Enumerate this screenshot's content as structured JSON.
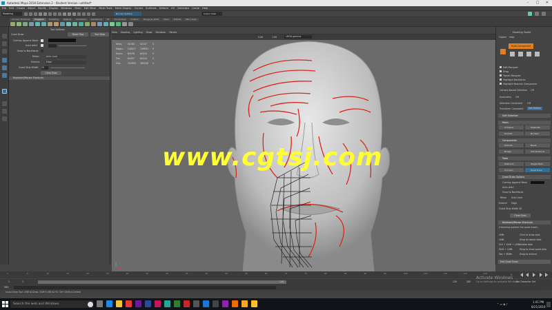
{
  "window": {
    "title": "Autodesk Maya 2016 Extension 2 - Student Version: untitled*"
  },
  "menubar": {
    "items": [
      "File",
      "Edit",
      "Create",
      "Select",
      "Modify",
      "Display",
      "Windows",
      "Mesh",
      "Edit Mesh",
      "Mesh Tools",
      "Mesh Display",
      "Curves",
      "Surfaces",
      "Deform",
      "UV",
      "Generate",
      "Cache",
      "Help"
    ]
  },
  "statusline": {
    "mode": "Modeling",
    "live_surface": "No Live Surface",
    "user": "Autem Shell"
  },
  "shelf": {
    "tabs": [
      "Curves / Surfaces",
      "Polygons",
      "Sculpting",
      "Rigging",
      "Animation",
      "Rendering",
      "FX",
      "FX Caching",
      "Custom",
      "Polygons_Pratt",
      "XGen",
      "Elfhold",
      "Nitro_User"
    ],
    "active_tab": "Polygons"
  },
  "tool_settings": {
    "header": "Tool Settings",
    "title": "Quad Draw",
    "reset": "Reset Tool",
    "help": "Tool Help",
    "overlay_label": "Overlay Append Mesh:",
    "auto_weld_label": "Auto weld:",
    "snap_label": "Snap to Backfaces",
    "relax_label": "Relax:",
    "relax_value": "Auto Lock",
    "extend_label": "Extend:",
    "extend_value": "Edge",
    "strip_label": "Quad Strip Width:",
    "strip_value": "20",
    "clear": "Clear Dots",
    "shortcuts": "Keyboard/Mouse Shortcuts"
  },
  "viewport": {
    "menu": [
      "View",
      "Shading",
      "Lighting",
      "Show",
      "Renderer",
      "Panels"
    ],
    "hud": [
      [
        "Verts:",
        "42180",
        "42147",
        "0"
      ],
      [
        "Edges:",
        "128017",
        "126091",
        "0"
      ],
      [
        "Faces:",
        "84576",
        "84110",
        "0"
      ],
      [
        "Tris:",
        "84497",
        "84110",
        "0"
      ],
      [
        "UVs:",
        "292903",
        "285346",
        "0"
      ]
    ],
    "gamma": "sRGB gamma",
    "val_a": "0.00",
    "val_b": "1.00"
  },
  "watermark": "www.cgtsj.com",
  "modeling_toolkit": {
    "header": "Modeling Toolkit",
    "tabs": [
      "Object",
      "Help"
    ],
    "component": "Multi-Component",
    "options": [
      "Edit Marquee",
      "Drag",
      "Tweak Marquee",
      "Highlight Backfaces",
      "Highlight Nearest Component"
    ],
    "camera_sel": "Camera Based Selection",
    "camera_val": "Off",
    "symmetry": "Symmetry",
    "symmetry_val": "Off",
    "constraint": "Selection Constraint",
    "constraint_val": "Off",
    "transform": "Transform Constraint",
    "transform_val": "Set Edition",
    "soft_sel": "Soft Selection",
    "mesh_hdr": "Mesh",
    "mesh_btns": [
      "Combine",
      "Separate",
      "Smooth",
      "Boolean"
    ],
    "comp_hdr": "Components",
    "comp_btns": [
      "Extrude",
      "Bevel",
      "Bridge",
      "Add Divisions"
    ],
    "tools_hdr": "Tools",
    "tools_btns": [
      "Multi-Cut",
      "Target Weld",
      "Connect",
      "Quad Draw"
    ],
    "qd_hdr": "Quad Draw Options",
    "qd_overlay": "Overlay Append Mesh",
    "qd_weld": "Auto weld",
    "qd_snap": "Snap to Backfaces",
    "qd_relax": "Relax",
    "qd_relax_v": "Auto Lock",
    "qd_extend": "Extend",
    "qd_extend_v": "Edge",
    "qd_strip": "Quad Strip Width",
    "qd_strip_v": "20",
    "qd_clear": "Clear Dots",
    "kb_hdr": "Keyboard/Mouse Shortcuts",
    "kb_desc": "(Hovering outside the quad mesh)",
    "kb_rows": [
      [
        "LMB:",
        "Click to draw dots"
      ],
      [
        "LMB:",
        "Drag to tweak dots"
      ],
      [
        "Ctrl + Shift + LMB:",
        "Delete dots"
      ],
      [
        "Shift + LMB:",
        "Drag to draw quad strip"
      ],
      [
        "Tab + MMB:",
        "Drag to extend"
      ]
    ],
    "exit": "Exit Quad Draw"
  },
  "timeline": {
    "ticks": [
      "1",
      "5",
      "10",
      "15",
      "20",
      "25",
      "30",
      "35",
      "40",
      "45",
      "50",
      "55",
      "60",
      "65",
      "70",
      "75",
      "80",
      "85",
      "90",
      "95",
      "100",
      "105",
      "110",
      "115",
      "120"
    ],
    "start": "1",
    "end": "120",
    "range_start": "1",
    "range_end": "120",
    "range_max": "200",
    "no_char": "No Character Set",
    "mel": "MEL"
  },
  "helpline": "Quad Draw Tool: LMB to Draw, Shift+LMB to Fill, Ctrl+Shift to Delete",
  "taskbar": {
    "search": "Search the web and Windows",
    "time": "1:41 PM",
    "date": "8/21/2016",
    "activate": "Activate Windows",
    "activate_sub": "Go to Settings to activate Windows."
  }
}
